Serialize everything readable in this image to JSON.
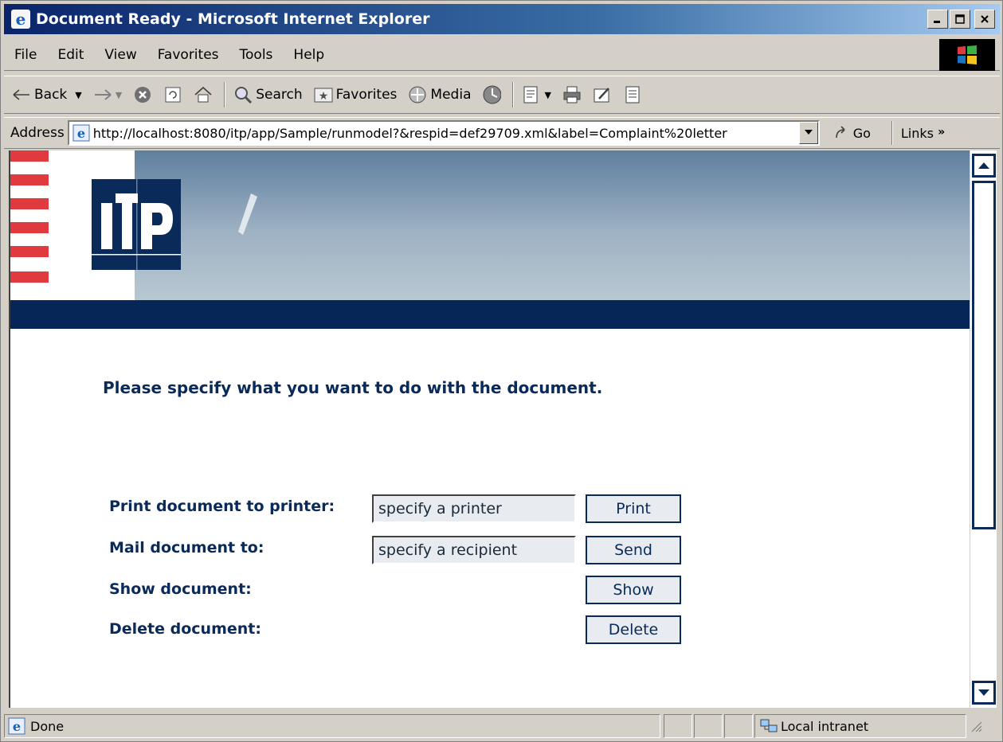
{
  "window": {
    "title": "Document Ready - Microsoft Internet Explorer"
  },
  "menu": {
    "items": [
      "File",
      "Edit",
      "View",
      "Favorites",
      "Tools",
      "Help"
    ]
  },
  "toolbar": {
    "back_label": "Back",
    "search_label": "Search",
    "favorites_label": "Favorites",
    "media_label": "Media"
  },
  "address": {
    "label": "Address",
    "url": "http://localhost:8080/itp/app/Sample/runmodel?&respid=def29709.xml&label=Complaint%20letter",
    "go_label": "Go",
    "links_label": "Links"
  },
  "page": {
    "logo_text": "ITP",
    "prompt": "Please specify what you want to do with the document.",
    "print_label": "Print document to printer:",
    "print_placeholder": "specify a printer",
    "print_button": "Print",
    "mail_label": "Mail document to:",
    "mail_placeholder": "specify a recipient",
    "mail_button": "Send",
    "show_label": "Show document:",
    "show_button": "Show",
    "delete_label": "Delete document:",
    "delete_button": "Delete"
  },
  "status": {
    "text": "Done",
    "zone": "Local intranet"
  },
  "colors": {
    "title_bar": "#0a246a",
    "page_navy": "#0a2a5a",
    "banner_bar": "#052656",
    "stripe_red": "#e03a3e"
  }
}
